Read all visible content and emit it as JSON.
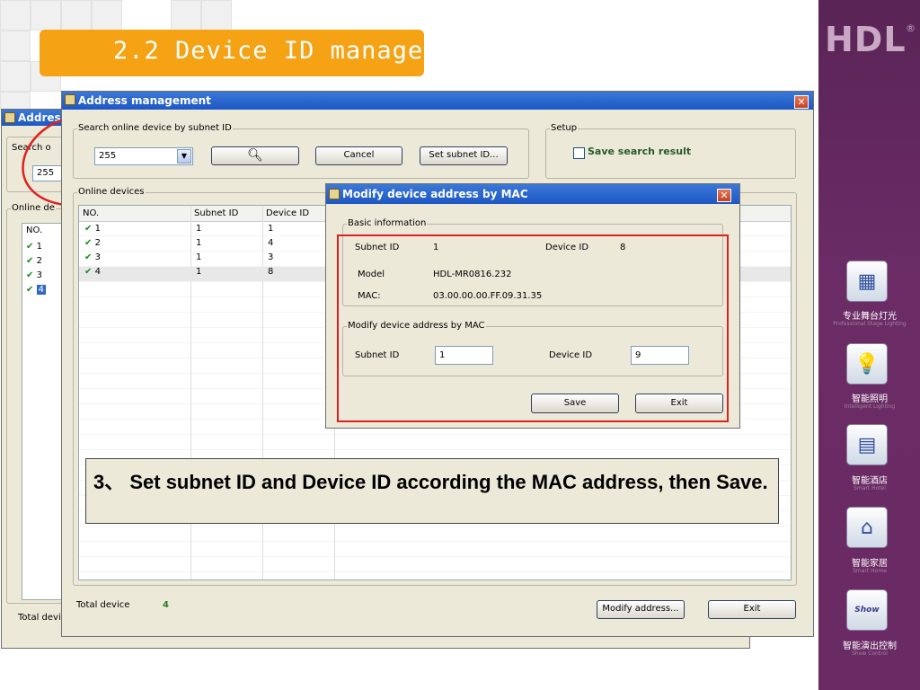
{
  "slide": {
    "title": "2.2 Device ID manage",
    "caption": "3、 Set subnet ID and Device ID according the MAC address, then Save."
  },
  "brand": {
    "logo": "HDL",
    "logo_mark": "®",
    "menu": [
      {
        "label": "专业舞台灯光",
        "sub": "Professional Stage Lighting",
        "icon": "stage-lighting-icon"
      },
      {
        "label": "智能照明",
        "sub": "Intelligent Lighting",
        "icon": "bulb-icon"
      },
      {
        "label": "智能酒店",
        "sub": "Smart Hotel",
        "icon": "hotel-icon"
      },
      {
        "label": "智能家居",
        "sub": "Smart Home",
        "icon": "home-icon"
      },
      {
        "label": "智能演出控制",
        "sub": "Show Control",
        "icon": "show-control-icon"
      }
    ],
    "show_badge": "Show"
  },
  "back_window": {
    "title": "Addres",
    "search_label": "Search o",
    "value": "255",
    "online_label": "Online de",
    "col_no": "NO.",
    "rows": [
      "1",
      "2",
      "3",
      "4"
    ],
    "total": "Total devic"
  },
  "main_window": {
    "title": "Address management",
    "search_group": "Search online device by subnet ID",
    "subnet_value": "255",
    "cancel": "Cancel",
    "set_subnet": "Set subnet ID...",
    "setup_group": "Setup",
    "save_search": "Save search result",
    "online_group": "Online devices",
    "columns": [
      "NO.",
      "Subnet ID",
      "Device ID"
    ],
    "rows": [
      {
        "no": "1",
        "subnet": "1",
        "device": "1"
      },
      {
        "no": "2",
        "subnet": "1",
        "device": "4"
      },
      {
        "no": "3",
        "subnet": "1",
        "device": "3"
      },
      {
        "no": "4",
        "subnet": "1",
        "device": "8"
      }
    ],
    "total_label": "Total device",
    "total_value": "4",
    "modify_btn": "Modify address...",
    "exit_btn": "Exit"
  },
  "dialog": {
    "title": "Modify device address by MAC",
    "basic_group": "Basic information",
    "subnet_label": "Subnet ID",
    "subnet_value": "1",
    "device_label": "Device ID",
    "device_value": "8",
    "model_label": "Model",
    "model_value": "HDL-MR0816.232",
    "mac_label": "MAC:",
    "mac_value": "03.00.00.00.FF.09.31.35",
    "modify_group": "Modify device address by MAC",
    "new_subnet_label": "Subnet ID",
    "new_subnet": "1",
    "new_device_label": "Device ID",
    "new_device": "9",
    "save": "Save",
    "exit": "Exit"
  }
}
